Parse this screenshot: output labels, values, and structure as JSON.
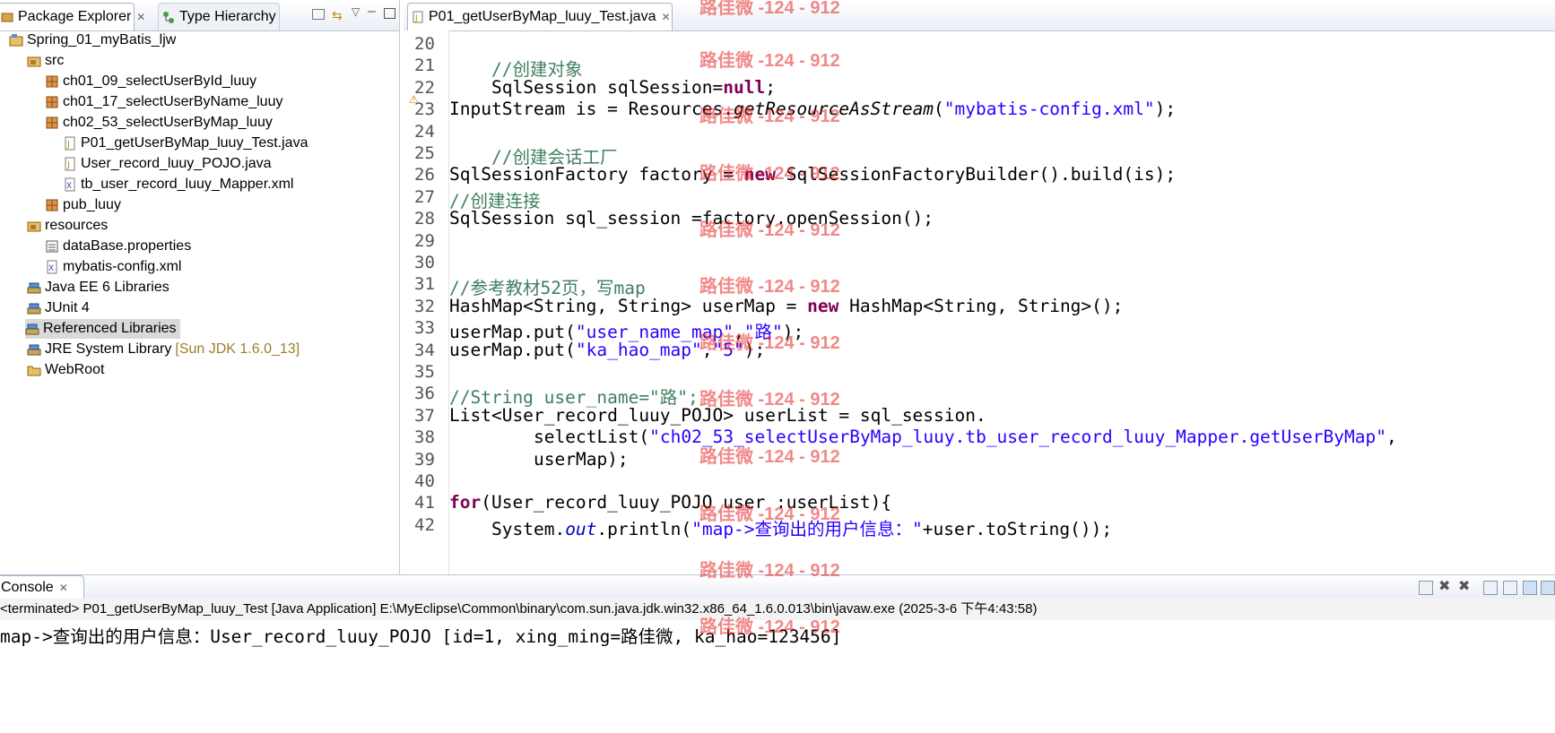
{
  "explorer": {
    "tab_package": "Package Explorer",
    "tab_hierarchy": "Type Hierarchy",
    "tree": [
      {
        "label": "Spring_01_myBatis_ljw",
        "icon": "project-icon"
      },
      {
        "label": "src",
        "icon": "src-folder-icon"
      },
      {
        "label": "ch01_09_selectUserById_luuy",
        "icon": "package-icon"
      },
      {
        "label": "ch01_17_selectUserByName_luuy",
        "icon": "package-icon"
      },
      {
        "label": "ch02_53_selectUserByMap_luuy",
        "icon": "package-icon"
      },
      {
        "label": "P01_getUserByMap_luuy_Test.java",
        "icon": "java-file-icon"
      },
      {
        "label": "User_record_luuy_POJO.java",
        "icon": "java-file-icon"
      },
      {
        "label": "tb_user_record_luuy_Mapper.xml",
        "icon": "xml-file-icon"
      },
      {
        "label": "pub_luuy",
        "icon": "package-icon"
      },
      {
        "label": "resources",
        "icon": "src-folder-icon"
      },
      {
        "label": "dataBase.properties",
        "icon": "properties-file-icon"
      },
      {
        "label": "mybatis-config.xml",
        "icon": "xml-file-icon"
      },
      {
        "label": "Java EE 6 Libraries",
        "icon": "library-icon"
      },
      {
        "label": "JUnit 4",
        "icon": "library-icon"
      },
      {
        "label": "Referenced Libraries",
        "icon": "library-icon"
      },
      {
        "label": "JRE System Library",
        "icon": "library-icon",
        "suffix": "[Sun JDK 1.6.0_13]"
      },
      {
        "label": "WebRoot",
        "icon": "folder-icon"
      }
    ]
  },
  "editor": {
    "tab_label": "P01_getUserByMap_luuy_Test.java",
    "line_numbers": [
      "20",
      "21",
      "22",
      "23",
      "24",
      "25",
      "26",
      "27",
      "28",
      "29",
      "30",
      "31",
      "32",
      "33",
      "34",
      "35",
      "36",
      "37",
      "38",
      "39",
      "40",
      "41",
      "42"
    ],
    "lines": {
      "l21": "//创建对象",
      "l22a": "SqlSession sqlSession=",
      "l22b": "null",
      "l22c": ";",
      "l23a": "InputStream is = Resources.",
      "l23b": "getResourceAsStream",
      "l23c": "(",
      "l23d": "\"mybatis-config.xml\"",
      "l23e": ");",
      "l25": "//创建会话工厂",
      "l26a": "SqlSessionFactory factory = ",
      "l26b": "new",
      "l26c": " SqlSessionFactoryBuilder().build(is);",
      "l27": "//创建连接",
      "l28": "SqlSession sql_session =factory.openSession();",
      "l31": "//参考教材52页，写map",
      "l32a": "HashMap<String, String> userMap = ",
      "l32b": "new",
      "l32c": " HashMap<String, String>();",
      "l33a": "userMap.put(",
      "l33b": "\"user_name_map\"",
      "l33c": ",",
      "l33d": "\"路\"",
      "l33e": ");",
      "l34a": "userMap.put(",
      "l34b": "\"ka_hao_map\"",
      "l34c": ",",
      "l34d": "\"5\"",
      "l34e": ");",
      "l36": "//String user_name=\"路\";",
      "l37": "List<User_record_luuy_POJO> userList = sql_session.",
      "l38a": "selectList(",
      "l38b": "\"ch02_53_selectUserByMap_luuy.tb_user_record_luuy_Mapper.getUserByMap\"",
      "l38c": ",",
      "l39": "userMap);",
      "l41a": "for",
      "l41b": "(User_record_luuy_POJO user :userList){",
      "l42a": "System.",
      "l42b": "out",
      "l42c": ".println(",
      "l42d": "\"map->查询出的用户信息：\"",
      "l42e": "+user.toString());"
    }
  },
  "console": {
    "tab_label": "Console",
    "status": "<terminated> P01_getUserByMap_luuy_Test [Java Application] E:\\MyEclipse\\Common\\binary\\com.sun.java.jdk.win32.x86_64_1.6.0.013\\bin\\javaw.exe (2025-3-6 下午4:43:58)",
    "output": "map->查询出的用户信息：User_record_luuy_POJO [id=1, xing_ming=路佳微, ka_hao=123456]"
  },
  "watermark": "路佳微 -124 - 912",
  "colors": {
    "keyword": "#7f0055",
    "string": "#2a00ff",
    "comment": "#3f7f5f",
    "watermark": "#e62828"
  }
}
